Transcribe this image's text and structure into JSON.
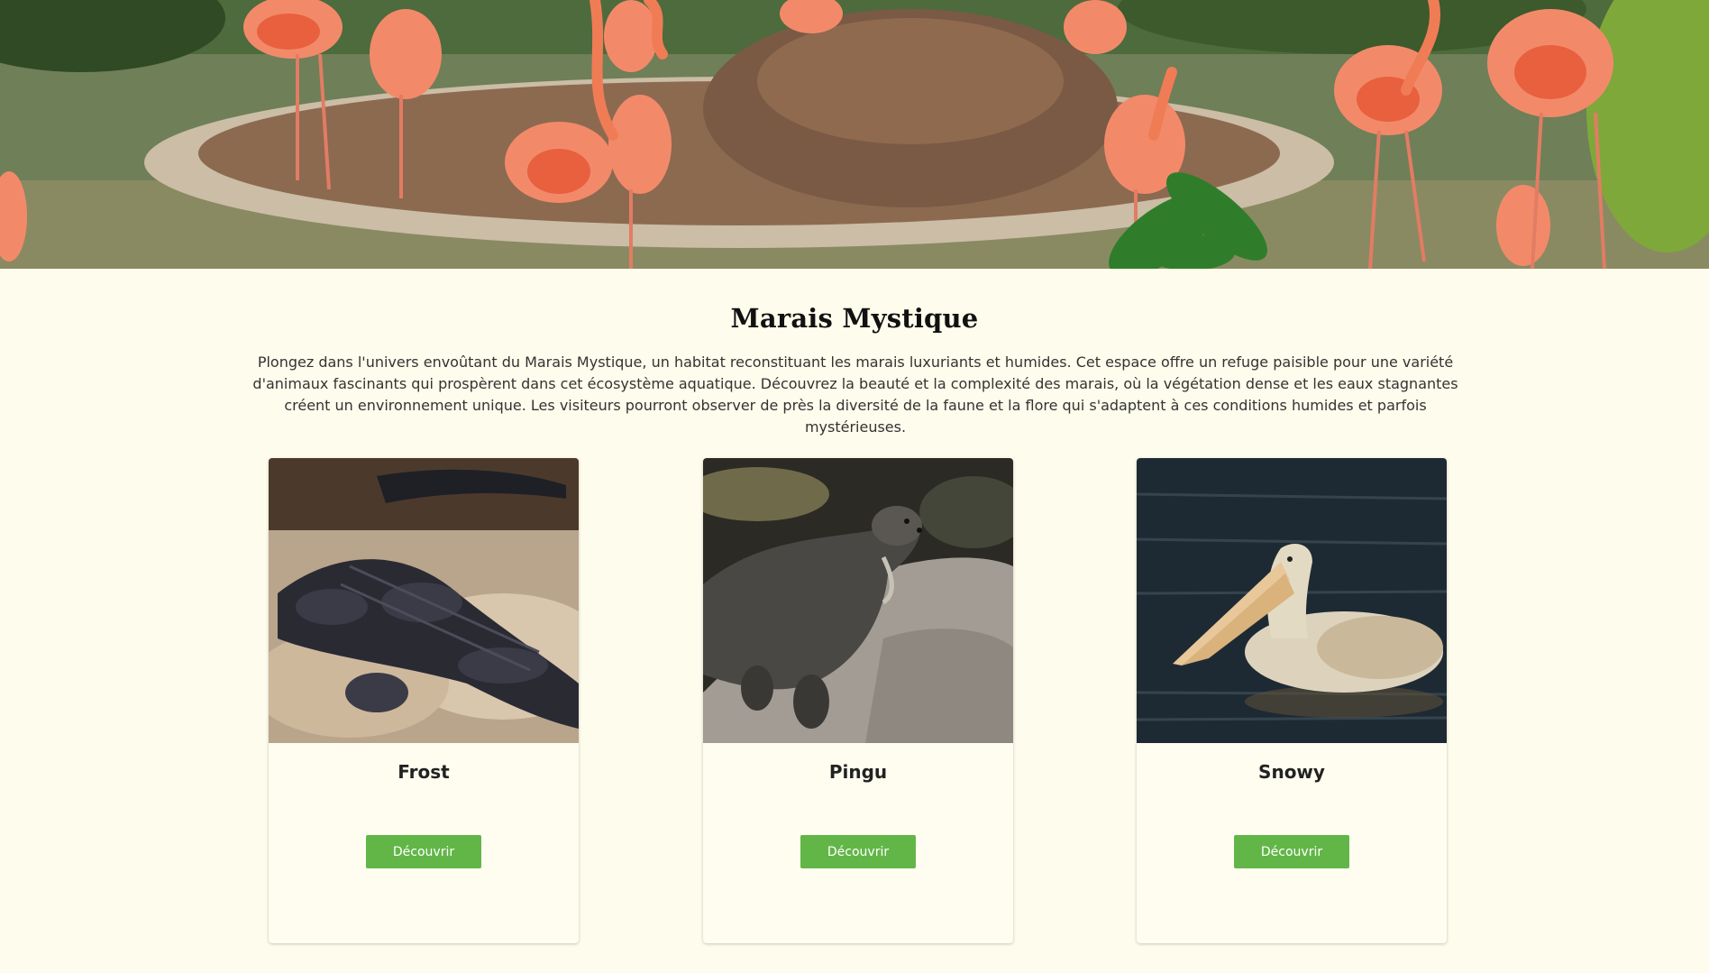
{
  "hero": {
    "image": "flamingos-in-pond-photo"
  },
  "habitat": {
    "title": "Marais Mystique",
    "description": "Plongez dans l'univers envoûtant du Marais Mystique, un habitat reconstituant les marais luxuriants et humides. Cet espace offre un refuge paisible pour une variété d'animaux fascinants qui prospèrent dans cet écosystème aquatique. Découvrez la beauté et la complexité des marais, où la végétation dense et les eaux stagnantes créent un environnement unique. Les visiteurs pourront observer de près la diversité de la faune et la flore qui s'adaptent à ces conditions humides et parfois mystérieuses."
  },
  "animals": [
    {
      "name": "Frost",
      "image": "alligator-photo",
      "button_label": "Découvrir"
    },
    {
      "name": "Pingu",
      "image": "otter-photo",
      "button_label": "Découvrir"
    },
    {
      "name": "Snowy",
      "image": "pelican-photo",
      "button_label": "Découvrir"
    }
  ],
  "colors": {
    "background": "#fefcec",
    "button": "#62b648",
    "button_text": "#ffffff"
  }
}
